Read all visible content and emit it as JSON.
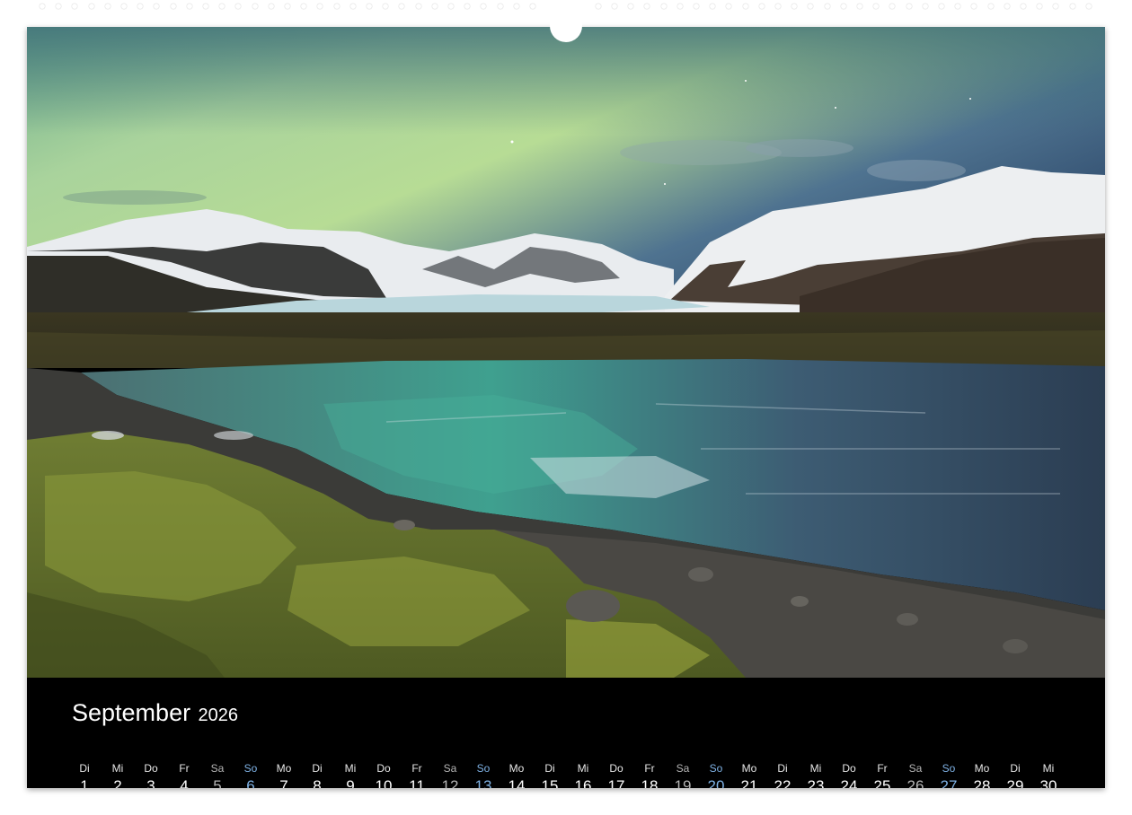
{
  "calendar": {
    "month": "September",
    "year": "2026",
    "colors": {
      "background": "#000000",
      "weekday": "#ffffff",
      "saturday": "#b5b5b5",
      "sunday": "#7fb2e5"
    },
    "days": [
      {
        "wd": "Di",
        "d": "1",
        "type": "wk"
      },
      {
        "wd": "Mi",
        "d": "2",
        "type": "wk"
      },
      {
        "wd": "Do",
        "d": "3",
        "type": "wk"
      },
      {
        "wd": "Fr",
        "d": "4",
        "type": "wk"
      },
      {
        "wd": "Sa",
        "d": "5",
        "type": "sat"
      },
      {
        "wd": "So",
        "d": "6",
        "type": "sun"
      },
      {
        "wd": "Mo",
        "d": "7",
        "type": "wk"
      },
      {
        "wd": "Di",
        "d": "8",
        "type": "wk"
      },
      {
        "wd": "Mi",
        "d": "9",
        "type": "wk"
      },
      {
        "wd": "Do",
        "d": "10",
        "type": "wk"
      },
      {
        "wd": "Fr",
        "d": "11",
        "type": "wk"
      },
      {
        "wd": "Sa",
        "d": "12",
        "type": "sat"
      },
      {
        "wd": "So",
        "d": "13",
        "type": "sun"
      },
      {
        "wd": "Mo",
        "d": "14",
        "type": "wk"
      },
      {
        "wd": "Di",
        "d": "15",
        "type": "wk"
      },
      {
        "wd": "Mi",
        "d": "16",
        "type": "wk"
      },
      {
        "wd": "Do",
        "d": "17",
        "type": "wk"
      },
      {
        "wd": "Fr",
        "d": "18",
        "type": "wk"
      },
      {
        "wd": "Sa",
        "d": "19",
        "type": "sat"
      },
      {
        "wd": "So",
        "d": "20",
        "type": "sun"
      },
      {
        "wd": "Mo",
        "d": "21",
        "type": "wk"
      },
      {
        "wd": "Di",
        "d": "22",
        "type": "wk"
      },
      {
        "wd": "Mi",
        "d": "23",
        "type": "wk"
      },
      {
        "wd": "Do",
        "d": "24",
        "type": "wk"
      },
      {
        "wd": "Fr",
        "d": "25",
        "type": "wk"
      },
      {
        "wd": "Sa",
        "d": "26",
        "type": "sat"
      },
      {
        "wd": "So",
        "d": "27",
        "type": "sun"
      },
      {
        "wd": "Mo",
        "d": "28",
        "type": "wk"
      },
      {
        "wd": "Di",
        "d": "29",
        "type": "wk"
      },
      {
        "wd": "Mi",
        "d": "30",
        "type": "wk"
      }
    ]
  }
}
